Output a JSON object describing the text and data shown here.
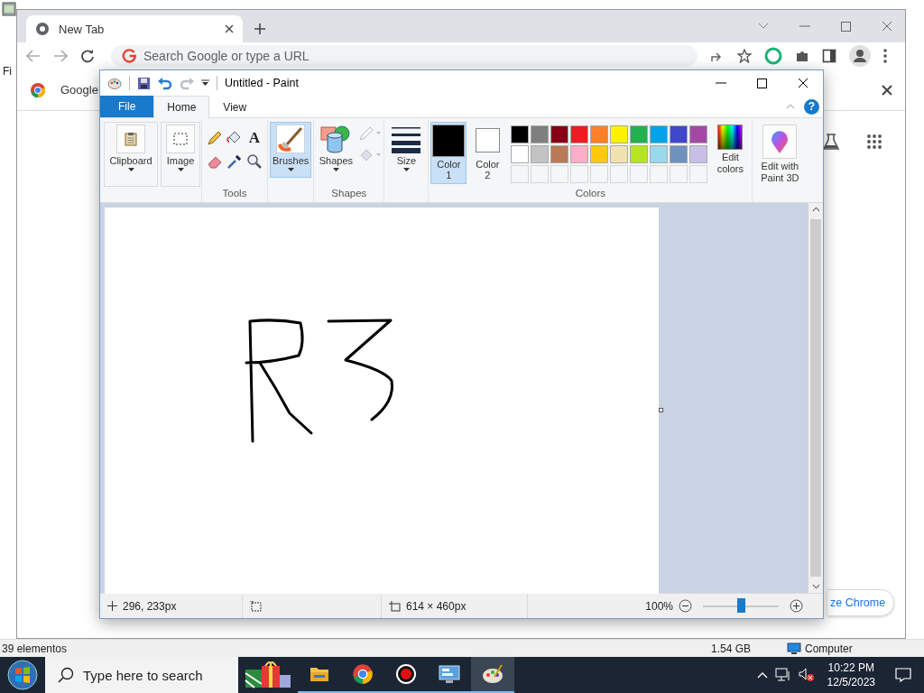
{
  "explorer": {
    "partial_label": "Fi",
    "status_bar": {
      "item_count": "39 elementos",
      "size": "1.54 GB",
      "location": "Computer"
    }
  },
  "chrome": {
    "tabs": [
      {
        "title": "New Tab",
        "selected": true
      }
    ],
    "omnibox": {
      "placeholder": "Search Google or type a URL"
    },
    "bookmarks": [
      {
        "label": "Google"
      }
    ],
    "customize_button": "ze Chrome"
  },
  "paint": {
    "title": "Untitled - Paint",
    "help_button": "?",
    "ribbon_tabs": [
      {
        "label": "File",
        "kind": "file",
        "selected": false
      },
      {
        "label": "Home",
        "kind": "tab",
        "selected": true
      },
      {
        "label": "View",
        "kind": "tab",
        "selected": false
      }
    ],
    "ribbon": {
      "clipboard": "Clipboard",
      "image": "Image",
      "text_tool": "A",
      "tools_label": "Tools",
      "brushes": {
        "label": "Brushes",
        "selected": true
      },
      "shapes_button": "Shapes",
      "shapes_label": "Shapes",
      "size": "Size",
      "colors": [
        {
          "label": "Color 1",
          "color": "#000000",
          "selected": true
        },
        {
          "label": "Color 2",
          "color": "#ffffff",
          "selected": false
        }
      ],
      "palette": [
        {
          "kind": "color",
          "color": "#000000"
        },
        {
          "kind": "color",
          "color": "#7f7f7f"
        },
        {
          "kind": "color",
          "color": "#880015"
        },
        {
          "kind": "color",
          "color": "#ed1c24"
        },
        {
          "kind": "color",
          "color": "#ff7f27"
        },
        {
          "kind": "color",
          "color": "#fff200"
        },
        {
          "kind": "color",
          "color": "#22b14c"
        },
        {
          "kind": "color",
          "color": "#00a2e8"
        },
        {
          "kind": "color",
          "color": "#3f48cc"
        },
        {
          "kind": "color",
          "color": "#a349a4"
        },
        {
          "kind": "color",
          "color": "#ffffff"
        },
        {
          "kind": "color",
          "color": "#c3c3c3"
        },
        {
          "kind": "color",
          "color": "#b97a57"
        },
        {
          "kind": "color",
          "color": "#ffaec9"
        },
        {
          "kind": "color",
          "color": "#ffc90e"
        },
        {
          "kind": "color",
          "color": "#efe4b0"
        },
        {
          "kind": "color",
          "color": "#b5e61d"
        },
        {
          "kind": "color",
          "color": "#99d9ea"
        },
        {
          "kind": "color",
          "color": "#7092be"
        },
        {
          "kind": "color",
          "color": "#c8bfe7"
        },
        {
          "kind": "empty"
        },
        {
          "kind": "empty"
        },
        {
          "kind": "empty"
        },
        {
          "kind": "empty"
        },
        {
          "kind": "empty"
        },
        {
          "kind": "empty"
        },
        {
          "kind": "empty"
        },
        {
          "kind": "empty"
        },
        {
          "kind": "empty"
        },
        {
          "kind": "empty"
        }
      ],
      "colors_label": "Colors",
      "edit_colors": "Edit colors",
      "paint3d": "Edit with Paint 3D"
    },
    "status_bar": {
      "cursor": "296, 233px",
      "canvas_size": "614 × 460px",
      "zoom": "100%",
      "zoom_slider": {
        "level": 0.5
      }
    }
  },
  "taskbar": {
    "search": {
      "placeholder": "Type here to search"
    },
    "apps": [
      {
        "kind": "explorer",
        "active": false
      },
      {
        "kind": "chrome",
        "active": false
      },
      {
        "kind": "recorder",
        "active": false
      },
      {
        "kind": "control-panel",
        "active": false
      },
      {
        "kind": "paint",
        "active": true
      }
    ],
    "clock": {
      "time": "10:22 PM",
      "date": "12/5/2023"
    }
  }
}
